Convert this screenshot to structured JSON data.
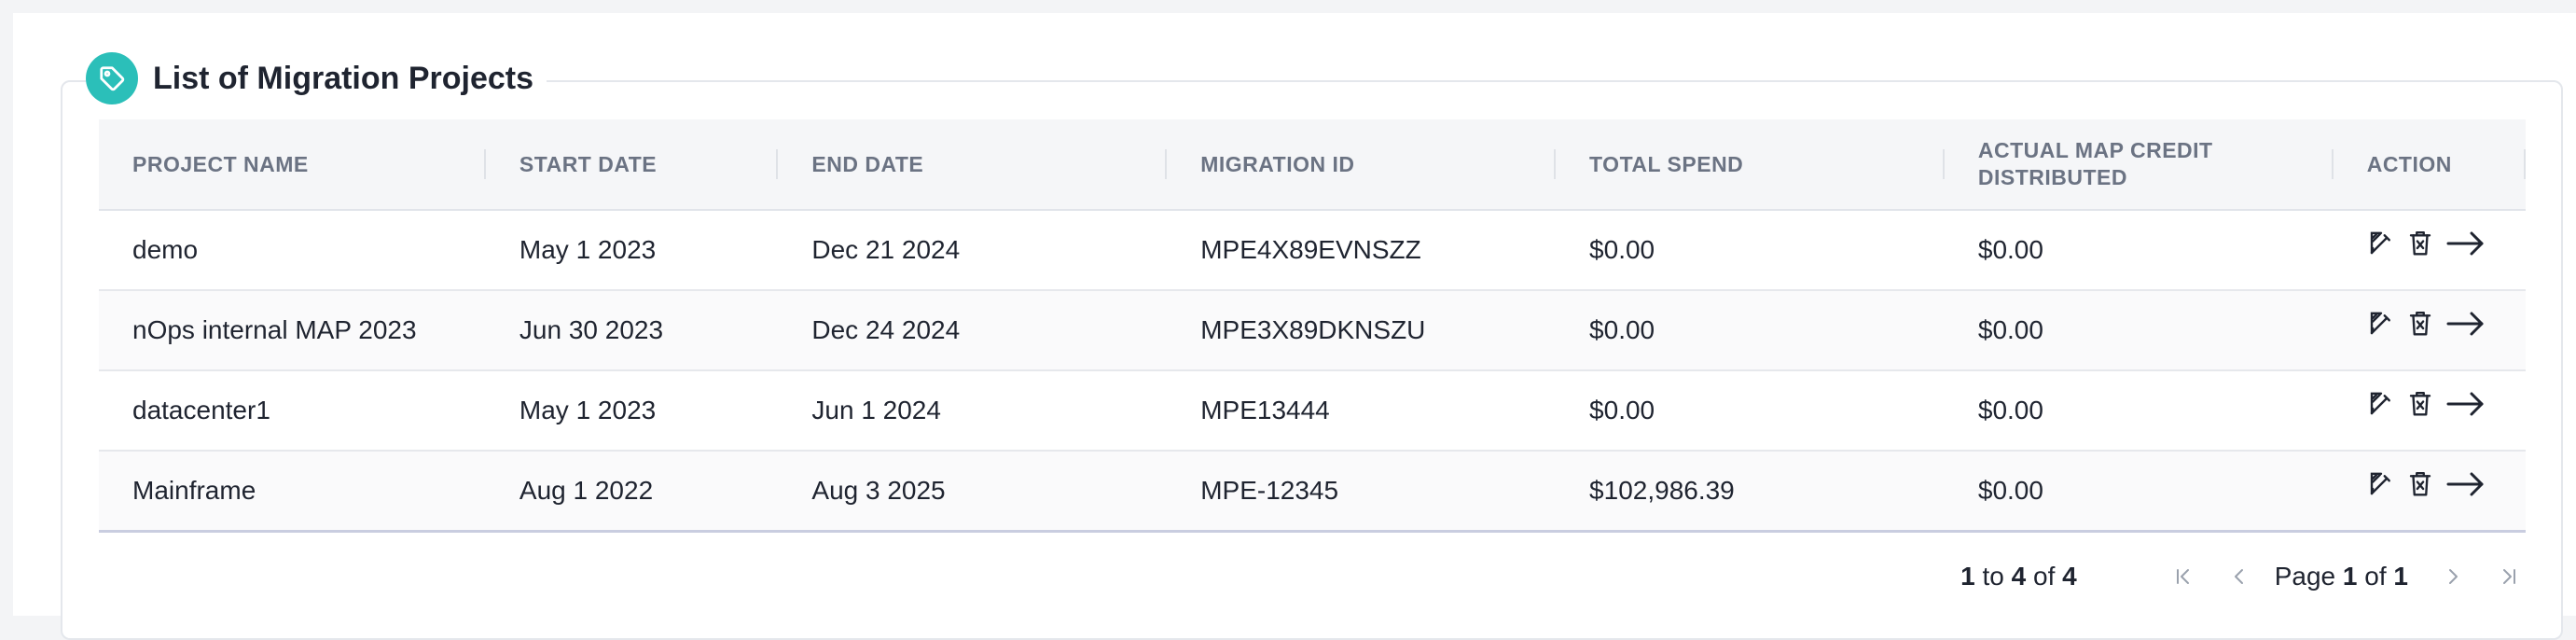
{
  "section": {
    "title": "List of Migration Projects"
  },
  "table": {
    "columns": [
      "PROJECT NAME",
      "START DATE",
      "END DATE",
      "MIGRATION ID",
      "TOTAL SPEND",
      "ACTUAL MAP CREDIT DISTRIBUTED",
      "ACTION"
    ],
    "rows": [
      {
        "project_name": "demo",
        "start_date": "May 1 2023",
        "end_date": "Dec 21 2024",
        "migration_id": "MPE4X89EVNSZZ",
        "total_spend": "$0.00",
        "map_credit": "$0.00"
      },
      {
        "project_name": "nOps internal MAP 2023",
        "start_date": "Jun 30 2023",
        "end_date": "Dec 24 2024",
        "migration_id": "MPE3X89DKNSZU",
        "total_spend": "$0.00",
        "map_credit": "$0.00"
      },
      {
        "project_name": "datacenter1",
        "start_date": "May 1 2023",
        "end_date": "Jun 1 2024",
        "migration_id": "MPE13444",
        "total_spend": "$0.00",
        "map_credit": "$0.00"
      },
      {
        "project_name": "Mainframe",
        "start_date": "Aug 1 2022",
        "end_date": "Aug 3 2025",
        "migration_id": "MPE-12345",
        "total_spend": "$102,986.39",
        "map_credit": "$0.00"
      }
    ],
    "action_icons": [
      "edit-icon",
      "delete-icon",
      "arrow-right-icon"
    ]
  },
  "pagination": {
    "from": "1",
    "to_word": "to",
    "to": "4",
    "of_word": "of",
    "total": "4",
    "page_word": "Page",
    "page": "1",
    "page_of_word": "of",
    "page_count": "1",
    "icons": [
      "first-page-icon",
      "prev-page-icon",
      "next-page-icon",
      "last-page-icon"
    ]
  },
  "colors": {
    "accent": "#2bbfb9",
    "header_bg": "#f5f6f8",
    "header_text": "#6b7383",
    "disabled_icon": "#9aa1ad"
  }
}
